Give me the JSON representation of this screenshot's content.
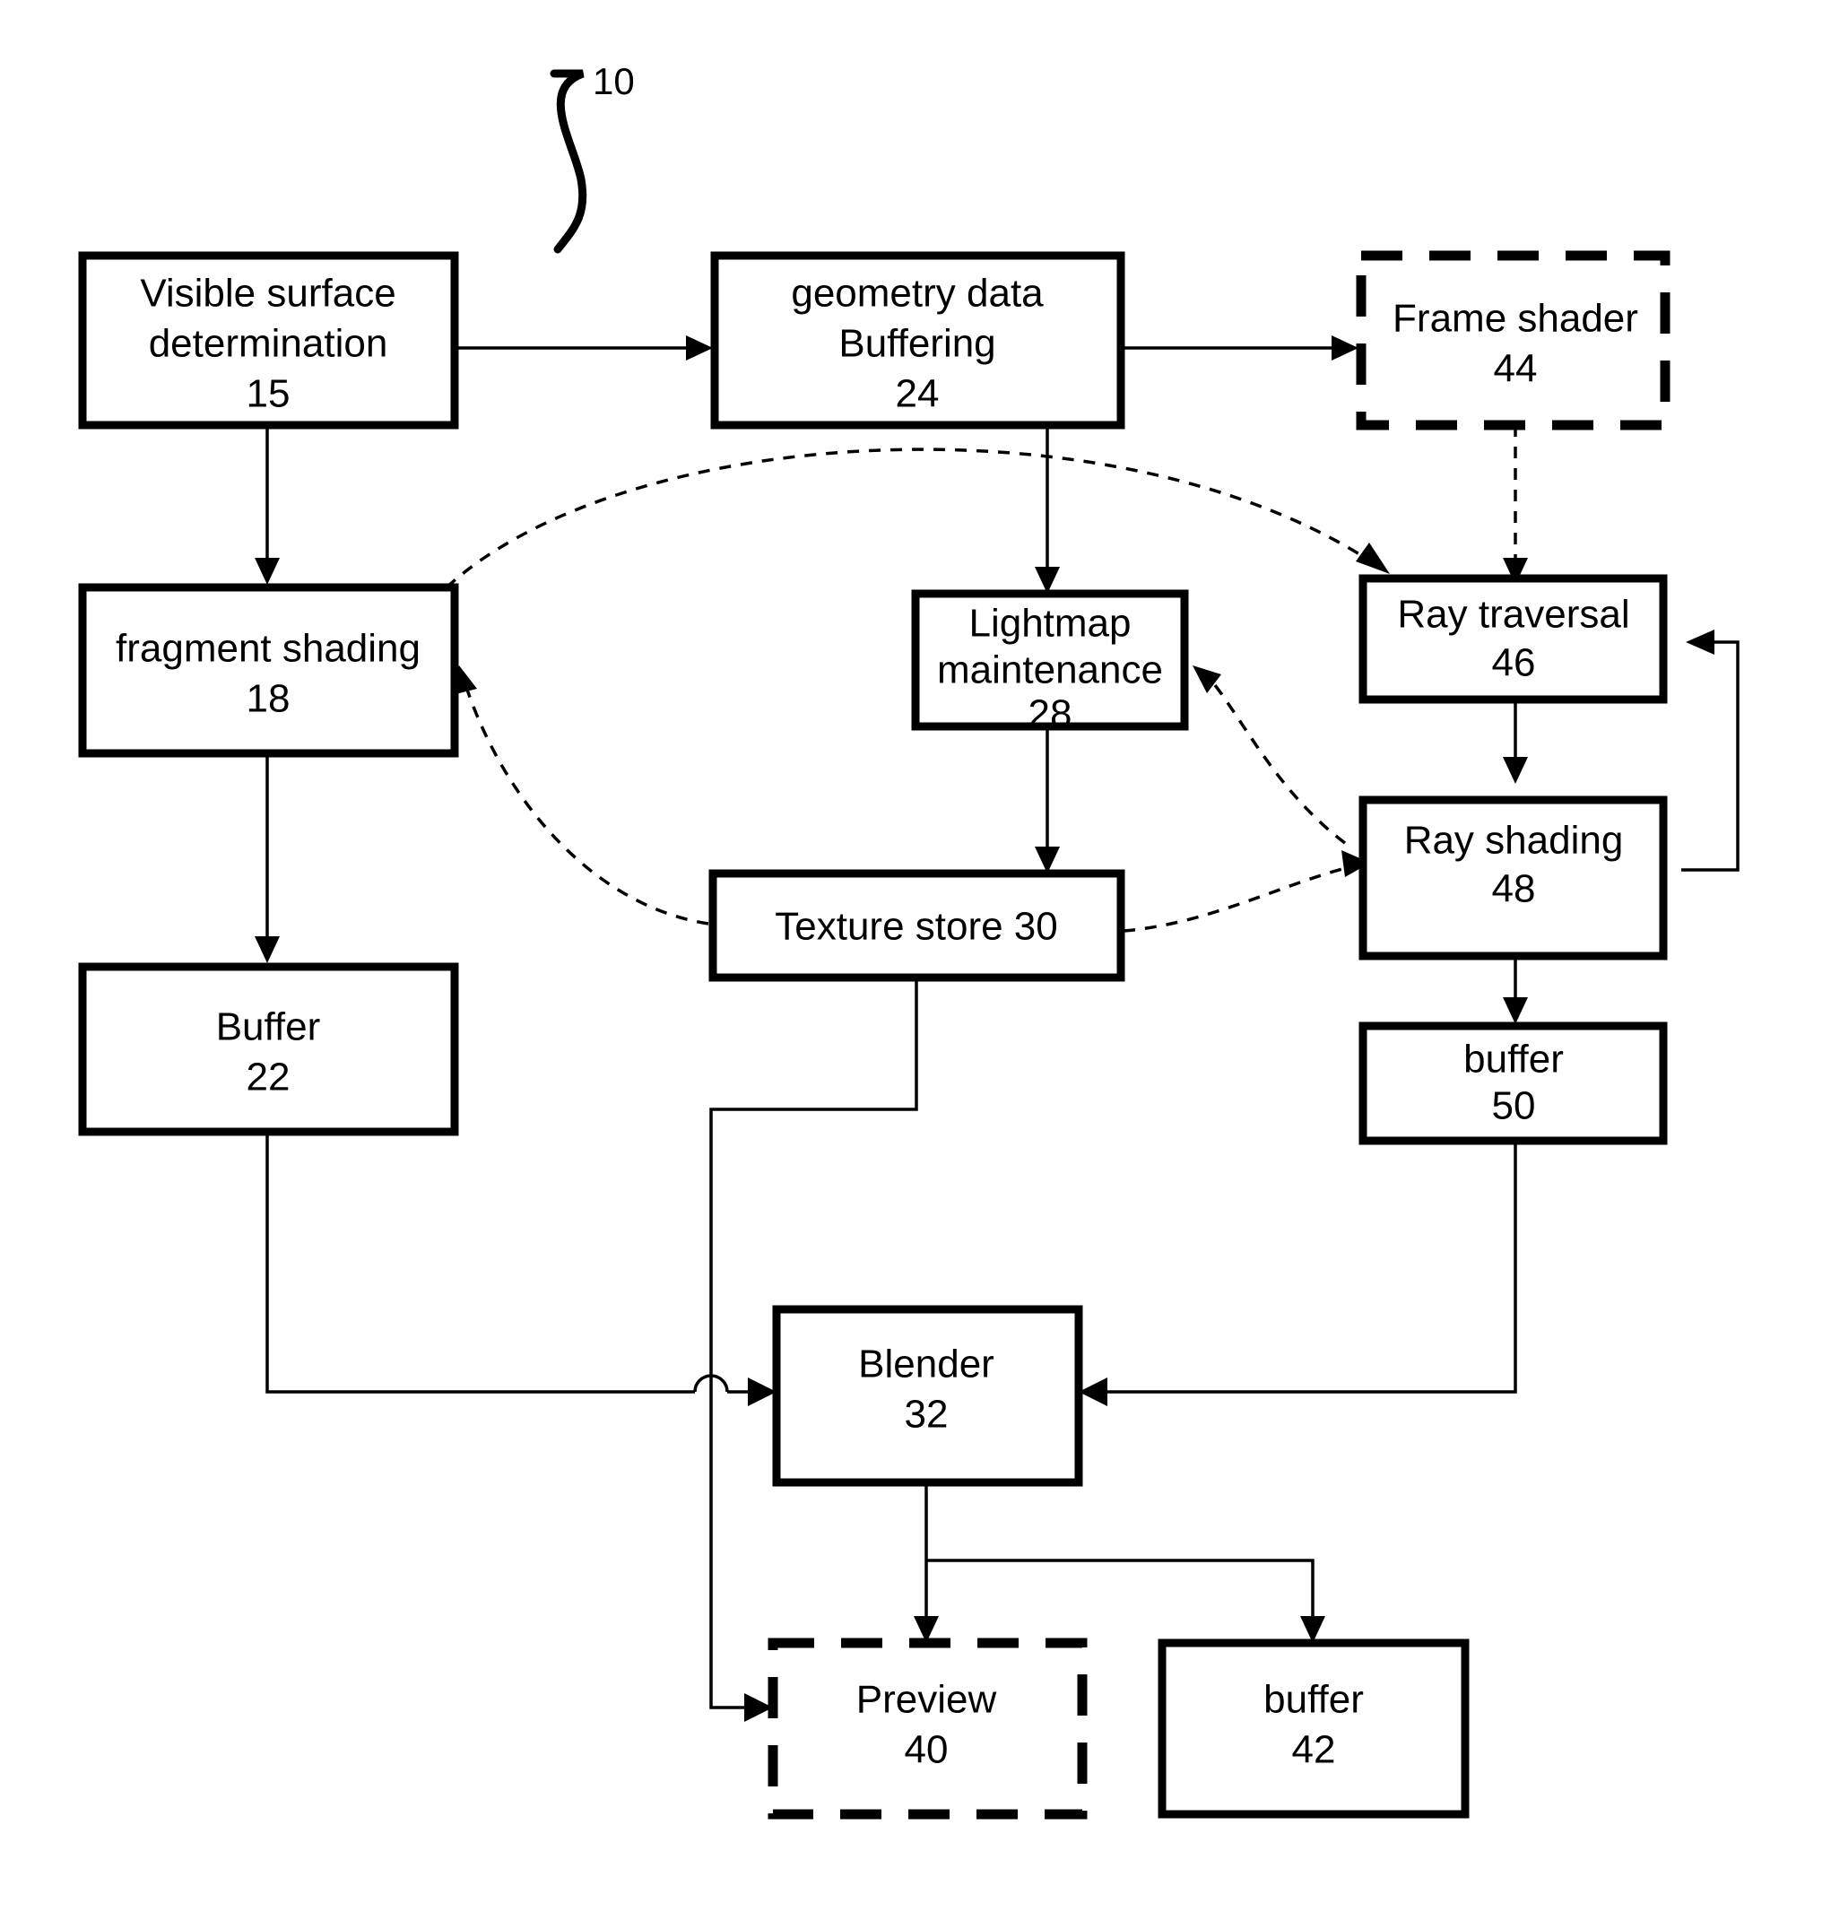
{
  "figure": {
    "reference_label": "10",
    "style": "patent-flow-diagram",
    "background_color": "#ffffff",
    "line_color": "#000000"
  },
  "nodes": [
    {
      "id": "visible-surface-determination",
      "lines": [
        "Visible surface",
        "determination"
      ],
      "ref": "15",
      "border": "solid"
    },
    {
      "id": "geometry-data-buffering",
      "lines": [
        "geometry data",
        "Buffering"
      ],
      "ref": "24",
      "border": "solid"
    },
    {
      "id": "frame-shader",
      "lines": [
        "Frame shader"
      ],
      "ref": "44",
      "border": "dashed"
    },
    {
      "id": "fragment-shading",
      "lines": [
        "fragment shading"
      ],
      "ref": "18",
      "border": "solid"
    },
    {
      "id": "lightmap-maintenance",
      "lines": [
        "Lightmap",
        "maintenance"
      ],
      "ref": "28",
      "border": "solid"
    },
    {
      "id": "ray-traversal",
      "lines": [
        "Ray traversal"
      ],
      "ref": "46",
      "border": "solid"
    },
    {
      "id": "texture-store",
      "lines": [
        "Texture store 30"
      ],
      "ref": "",
      "border": "solid"
    },
    {
      "id": "ray-shading",
      "lines": [
        "Ray shading"
      ],
      "ref": "48",
      "border": "solid"
    },
    {
      "id": "buffer-22",
      "lines": [
        "Buffer"
      ],
      "ref": "22",
      "border": "solid"
    },
    {
      "id": "buffer-50",
      "lines": [
        "buffer"
      ],
      "ref": "50",
      "border": "solid"
    },
    {
      "id": "blender",
      "lines": [
        "Blender"
      ],
      "ref": "32",
      "border": "solid"
    },
    {
      "id": "preview",
      "lines": [
        "Preview"
      ],
      "ref": "40",
      "border": "dashed"
    },
    {
      "id": "buffer-42",
      "lines": [
        "buffer"
      ],
      "ref": "42",
      "border": "solid"
    }
  ],
  "edges": [
    {
      "from": "visible-surface-determination",
      "to": "geometry-data-buffering",
      "style": "solid"
    },
    {
      "from": "geometry-data-buffering",
      "to": "frame-shader",
      "style": "solid"
    },
    {
      "from": "visible-surface-determination",
      "to": "fragment-shading",
      "style": "solid"
    },
    {
      "from": "geometry-data-buffering",
      "to": "lightmap-maintenance",
      "style": "solid"
    },
    {
      "from": "frame-shader",
      "to": "ray-traversal",
      "style": "dashed"
    },
    {
      "from": "fragment-shading",
      "to": "ray-traversal",
      "style": "dashed"
    },
    {
      "from": "texture-store",
      "to": "fragment-shading",
      "style": "dashed"
    },
    {
      "from": "texture-store",
      "to": "ray-shading",
      "style": "dashed"
    },
    {
      "from": "ray-shading",
      "to": "lightmap-maintenance",
      "style": "dashed"
    },
    {
      "from": "ray-traversal",
      "to": "ray-shading",
      "style": "solid"
    },
    {
      "from": "ray-shading",
      "to": "ray-traversal",
      "style": "solid"
    },
    {
      "from": "lightmap-maintenance",
      "to": "texture-store",
      "style": "solid"
    },
    {
      "from": "fragment-shading",
      "to": "buffer-22",
      "style": "solid"
    },
    {
      "from": "ray-shading",
      "to": "buffer-50",
      "style": "solid"
    },
    {
      "from": "buffer-22",
      "to": "blender",
      "style": "solid"
    },
    {
      "from": "buffer-50",
      "to": "blender",
      "style": "solid"
    },
    {
      "from": "texture-store",
      "to": "preview",
      "style": "solid"
    },
    {
      "from": "blender",
      "to": "preview",
      "style": "solid"
    },
    {
      "from": "blender",
      "to": "buffer-42",
      "style": "solid"
    }
  ]
}
